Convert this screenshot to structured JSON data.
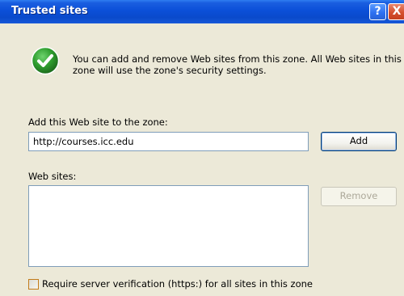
{
  "window": {
    "title": "Trusted sites",
    "help_label": "?",
    "close_label": "X"
  },
  "intro": {
    "icon": "green-check-icon",
    "text": "You can add and remove Web sites from this zone. All Web sites in this zone will use the zone's security settings."
  },
  "add_section": {
    "label": "Add this Web site to the zone:",
    "input_value": "http://courses.icc.edu",
    "add_button_label": "Add"
  },
  "websites": {
    "label": "Web sites:",
    "items": [],
    "remove_button_label": "Remove"
  },
  "https_option": {
    "label": "Require server verification (https:) for all sites in this zone",
    "checked": false
  },
  "colors": {
    "titlebar": "#0a4acb",
    "dialog_bg": "#ece9d8",
    "check_green": "#2f9e2f",
    "disabled_text": "#aca899"
  }
}
